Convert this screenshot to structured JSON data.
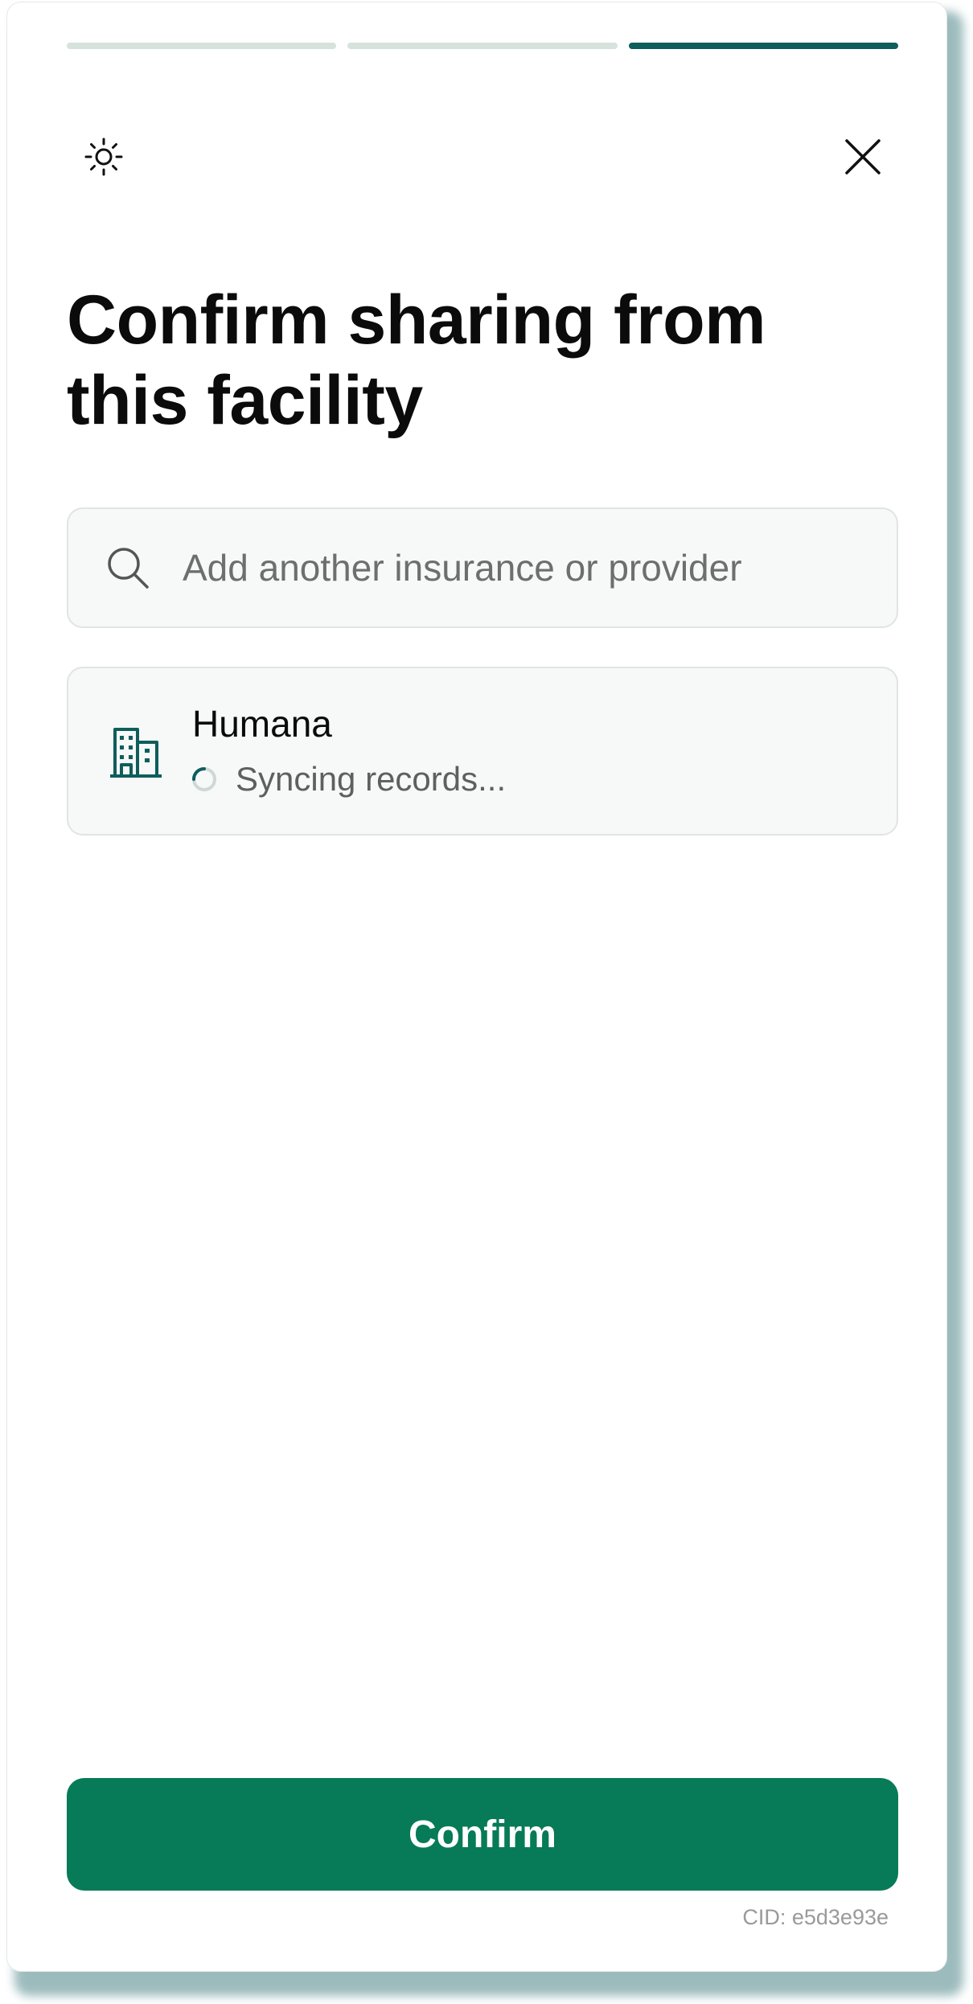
{
  "progress": {
    "steps": 3,
    "current_step": 3
  },
  "header": {
    "theme_icon": "sun-icon",
    "close_icon": "close-icon"
  },
  "title": "Confirm sharing from this facility",
  "search": {
    "icon": "search-icon",
    "placeholder": "Add another insurance or provider",
    "value": ""
  },
  "providers": [
    {
      "icon": "building-icon",
      "name": "Humana",
      "status": "Syncing records..."
    }
  ],
  "confirm_label": "Confirm",
  "cid": "CID: e5d3e93e",
  "colors": {
    "accent": "#077a57",
    "progress_active": "#0e5e5c",
    "progress_inactive": "#d6e3dc",
    "icon_teal": "#0e5e5c"
  }
}
